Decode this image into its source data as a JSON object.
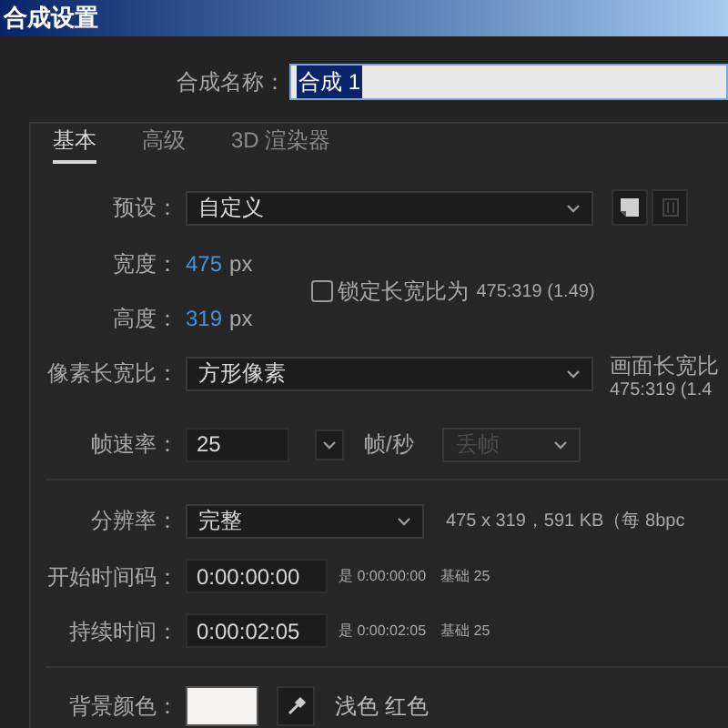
{
  "window": {
    "title": "合成设置"
  },
  "composition_name": {
    "label": "合成名称：",
    "value": "合成 1"
  },
  "tabs": [
    {
      "label": "基本",
      "selected": true
    },
    {
      "label": "高级",
      "selected": false
    },
    {
      "label": "3D 渲染器",
      "selected": false
    }
  ],
  "preset": {
    "label": "预设：",
    "value": "自定义"
  },
  "width": {
    "label": "宽度：",
    "value": "475",
    "unit": "px"
  },
  "height": {
    "label": "高度：",
    "value": "319",
    "unit": "px"
  },
  "lock_aspect": {
    "label": "锁定长宽比为",
    "ratio": "475:319 (1.49)",
    "checked": false
  },
  "pixel_aspect": {
    "label": "像素长宽比：",
    "value": "方形像素"
  },
  "frame_aspect": {
    "label": "画面长宽比",
    "value": "475:319 (1.4"
  },
  "frame_rate": {
    "label": "帧速率：",
    "value": "25",
    "unit": "帧/秒",
    "drop_frame": {
      "value": "丢帧",
      "disabled": true
    }
  },
  "resolution": {
    "label": "分辨率：",
    "value": "完整",
    "info": "475 x 319，591 KB（每 8bpc"
  },
  "start_timecode": {
    "label": "开始时间码：",
    "value": "0:00:00:00",
    "info": "是 0:00:00:00",
    "base": "基础 25"
  },
  "duration": {
    "label": "持续时间：",
    "value": "0:00:02:05",
    "info": "是 0:00:02:05",
    "base": "基础 25"
  },
  "background": {
    "label": "背景颜色：",
    "color": "#f5f3f2",
    "name": "浅色 红色"
  }
}
